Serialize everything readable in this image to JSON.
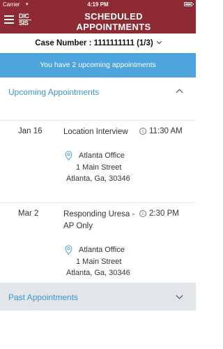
{
  "status": {
    "carrier": "Carrier",
    "time": "4:19 PM"
  },
  "app": {
    "logo_line1": "DIC",
    "logo_line2": "SIS",
    "title_line1": "SCHEDULED",
    "title_line2": "APPOINTMENTS"
  },
  "case": {
    "label": "Case Number : 1111111111 (1/3)"
  },
  "banner": {
    "text": "You have 2 upcoming appointments"
  },
  "upcoming": {
    "label": "Upcoming Appointments",
    "appointments": [
      {
        "date": "Jan 16",
        "name": "Location Interview",
        "time": "11:30 AM",
        "office": "Atlanta Office",
        "street": "1 Main Street",
        "city": "Atlanta, Ga, 30346"
      },
      {
        "date": "Mar 2",
        "name": "Responding Uresa - AP Only",
        "time": "2:30 PM",
        "office": "Atlanta Office",
        "street": "1 Main Street",
        "city": "Atlanta, Ga, 30346"
      }
    ]
  },
  "past": {
    "label": "Past Appointments"
  },
  "colors": {
    "brand": "#8e2a34",
    "banner": "#4da3dc",
    "link": "#3a94cf",
    "past_bg": "#e1e6e9"
  },
  "icons": {
    "menu": "hamburger-icon",
    "info": "info-circle-icon",
    "pin": "map-pin-icon",
    "expand": "chevron-up-icon",
    "collapse": "chevron-down-icon"
  }
}
